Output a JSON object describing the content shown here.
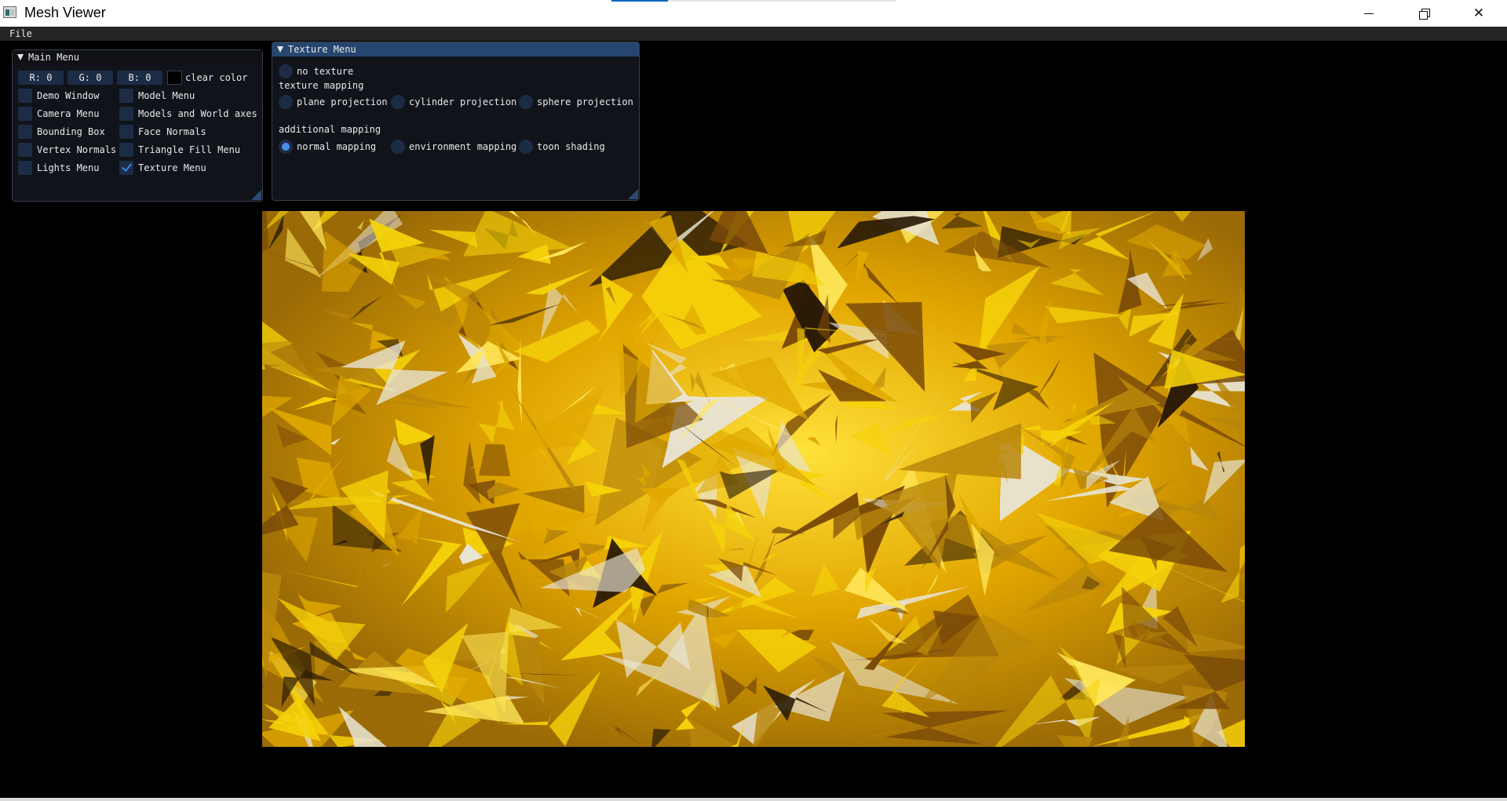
{
  "window": {
    "title": "Mesh Viewer",
    "minimize_glyph": "",
    "close_glyph": "✕"
  },
  "menubar": {
    "file": "File"
  },
  "main_menu": {
    "title": "Main Menu",
    "clear_color": {
      "r": "R:  0",
      "g": "G:  0",
      "b": "B:  0",
      "label": "clear color",
      "value": "#000000"
    },
    "checkboxes": [
      {
        "label": "Demo Window",
        "checked": false
      },
      {
        "label": "Camera Menu",
        "checked": false
      },
      {
        "label": "Bounding Box",
        "checked": false
      },
      {
        "label": "Vertex Normals",
        "checked": false
      },
      {
        "label": "Lights Menu",
        "checked": false
      },
      {
        "label": "Model Menu",
        "checked": false
      },
      {
        "label": "Models and World axes",
        "checked": false
      },
      {
        "label": "Face Normals",
        "checked": false
      },
      {
        "label": "Triangle Fill Menu",
        "checked": false
      },
      {
        "label": "Texture Menu",
        "checked": true
      }
    ]
  },
  "texture_menu": {
    "title": "Texture Menu",
    "no_texture": "no texture",
    "texture_mapping_label": "texture mapping",
    "texture_mapping": [
      "plane projection",
      "cylinder projection",
      "sphere projection"
    ],
    "additional_mapping_label": "additional mapping",
    "additional_mapping": [
      "normal mapping",
      "environment mapping",
      "toon shading"
    ],
    "selected": "normal mapping"
  },
  "viewport": {
    "content": "golden crystal textured mesh",
    "palette": [
      "#f5d20a",
      "#e0a800",
      "#b8860b",
      "#7a4a08",
      "#2a1a06",
      "#e8e4d4",
      "#ffe75a"
    ]
  },
  "icons": {
    "app": "app-icon",
    "minimize": "minimize-icon",
    "restore": "restore-icon",
    "close": "close-icon",
    "collapse": "collapse-arrow-icon",
    "check": "check-icon"
  }
}
